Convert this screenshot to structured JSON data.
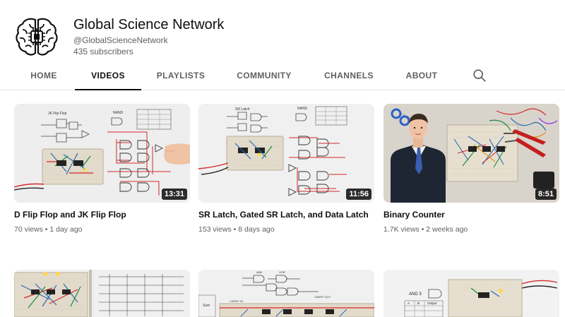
{
  "channel": {
    "name": "Global Science Network",
    "handle": "@GlobalScienceNetwork",
    "subscribers": "435 subscribers",
    "avatar_icon": "brain-chip-icon"
  },
  "tabs": [
    {
      "label": "HOME"
    },
    {
      "label": "VIDEOS"
    },
    {
      "label": "PLAYLISTS"
    },
    {
      "label": "COMMUNITY"
    },
    {
      "label": "CHANNELS"
    },
    {
      "label": "ABOUT"
    }
  ],
  "active_tab": "VIDEOS",
  "search_icon": "search-icon",
  "videos": [
    {
      "title": "D Flip Flop and JK Flip Flop",
      "views": "70 views",
      "age": "1 day ago",
      "duration": "13:31"
    },
    {
      "title": "SR Latch, Gated SR Latch, and Data Latch",
      "views": "153 views",
      "age": "8 days ago",
      "duration": "11:56"
    },
    {
      "title": "Binary Counter",
      "views": "1.7K views",
      "age": "2 weeks ago",
      "duration": "8:51"
    },
    {
      "title": "",
      "views": "",
      "age": "",
      "duration": ""
    },
    {
      "title": "",
      "views": "",
      "age": "",
      "duration": ""
    },
    {
      "title": "",
      "views": "",
      "age": "",
      "duration": ""
    }
  ],
  "thumb_text": {
    "v1_label": "JK Flip Flop",
    "v1_nand": "NAND",
    "v2_label": "SR Latch",
    "v2_nand": "NAND",
    "v5_and": "AND",
    "v5_xor": "XOR",
    "v5_carry_in": "CARRY IN",
    "v5_carry_out": "CARRY OUT",
    "v5_sum": "Sum",
    "v6_and3": "AND 3",
    "v6_a": "A",
    "v6_b": "B",
    "v6_output": "Output"
  },
  "colors": {
    "text_primary": "#0f0f0f",
    "text_secondary": "#606060",
    "divider": "#e5e5e5",
    "breadboard": "#e8e2d6",
    "wire_red": "#d62828"
  }
}
